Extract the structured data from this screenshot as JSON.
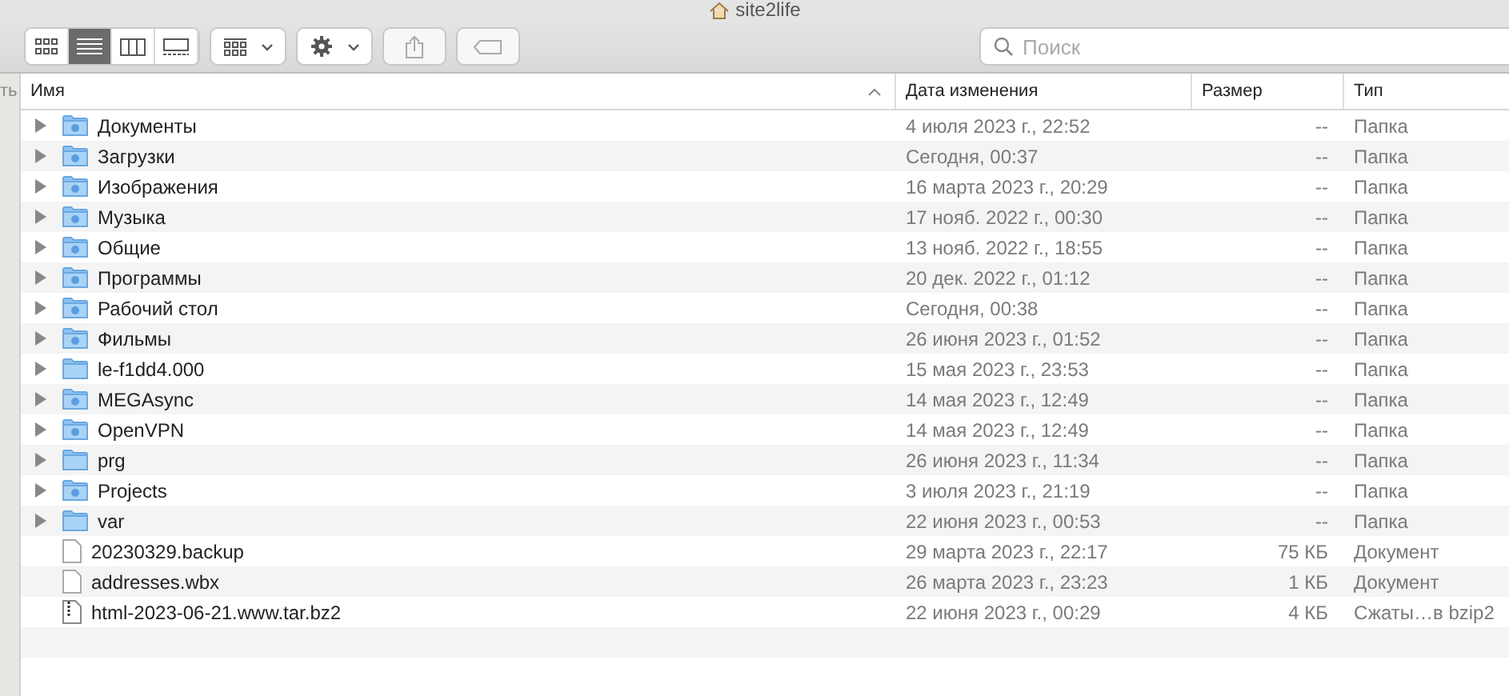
{
  "window": {
    "title": "site2life"
  },
  "sidebar": {
    "label": "ть"
  },
  "view_modes": [
    {
      "kind": "icons",
      "selected": false
    },
    {
      "kind": "list",
      "selected": true
    },
    {
      "kind": "columns",
      "selected": false
    },
    {
      "kind": "gallery",
      "selected": false
    }
  ],
  "search": {
    "placeholder": "Поиск"
  },
  "table": {
    "columns": [
      {
        "label": "Имя",
        "sorted": true
      },
      {
        "label": "Дата изменения",
        "sorted": false
      },
      {
        "label": "Размер",
        "sorted": false
      },
      {
        "label": "Тип",
        "sorted": false
      }
    ],
    "rows": [
      {
        "kind": "emblem-folder",
        "name": "Документы",
        "date": "4 июля 2023 г., 22:52",
        "size": "--",
        "type": "Папка"
      },
      {
        "kind": "emblem-folder",
        "name": "Загрузки",
        "date": "Сегодня, 00:37",
        "size": "--",
        "type": "Папка"
      },
      {
        "kind": "emblem-folder",
        "name": "Изображения",
        "date": "16 марта 2023 г., 20:29",
        "size": "--",
        "type": "Папка"
      },
      {
        "kind": "emblem-folder",
        "name": "Музыка",
        "date": "17 нояб. 2022 г., 00:30",
        "size": "--",
        "type": "Папка"
      },
      {
        "kind": "emblem-folder",
        "name": "Общие",
        "date": "13 нояб. 2022 г., 18:55",
        "size": "--",
        "type": "Папка"
      },
      {
        "kind": "emblem-folder",
        "name": "Программы",
        "date": "20 дек. 2022 г., 01:12",
        "size": "--",
        "type": "Папка"
      },
      {
        "kind": "emblem-folder",
        "name": "Рабочий стол",
        "date": "Сегодня, 00:38",
        "size": "--",
        "type": "Папка"
      },
      {
        "kind": "emblem-folder",
        "name": "Фильмы",
        "date": "26 июня 2023 г., 01:52",
        "size": "--",
        "type": "Папка"
      },
      {
        "kind": "folder",
        "name": "le-f1dd4.000",
        "date": "15 мая 2023 г., 23:53",
        "size": "--",
        "type": "Папка"
      },
      {
        "kind": "emblem-folder",
        "name": "MEGAsync",
        "date": "14 мая 2023 г., 12:49",
        "size": "--",
        "type": "Папка"
      },
      {
        "kind": "emblem-folder",
        "name": "OpenVPN",
        "date": "14 мая 2023 г., 12:49",
        "size": "--",
        "type": "Папка"
      },
      {
        "kind": "folder",
        "name": "prg",
        "date": "26 июня 2023 г., 11:34",
        "size": "--",
        "type": "Папка"
      },
      {
        "kind": "emblem-folder",
        "name": "Projects",
        "date": "3 июля 2023 г., 21:19",
        "size": "--",
        "type": "Папка"
      },
      {
        "kind": "folder",
        "name": "var",
        "date": "22 июня 2023 г., 00:53",
        "size": "--",
        "type": "Папка"
      },
      {
        "kind": "document",
        "name": "20230329.backup",
        "date": "29 марта 2023 г., 22:17",
        "size": "75 КБ",
        "type": "Документ"
      },
      {
        "kind": "document",
        "name": "addresses.wbx",
        "date": "26 марта 2023 г., 23:23",
        "size": "1 КБ",
        "type": "Документ"
      },
      {
        "kind": "archive",
        "name": "html-2023-06-21.www.tar.bz2",
        "date": "22 июня 2023 г., 00:29",
        "size": "4 КБ",
        "type": "Сжаты…в bzip2"
      }
    ]
  }
}
